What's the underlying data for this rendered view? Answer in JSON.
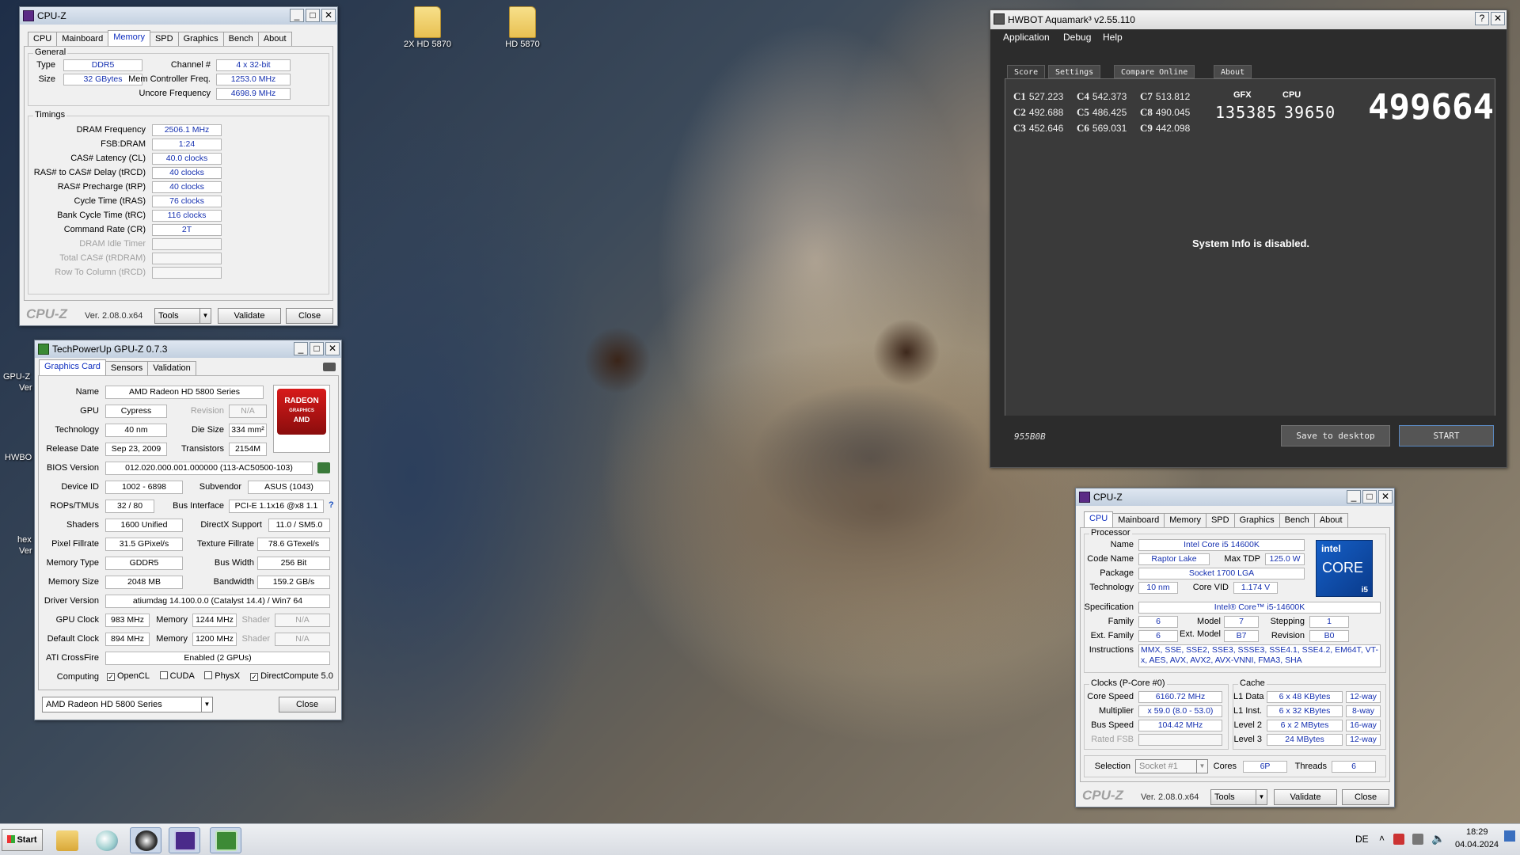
{
  "desktop": {
    "icons": [
      {
        "label": "2X HD 5870"
      },
      {
        "label": "HD 5870"
      }
    ],
    "partial_labels": [
      "GPU-Z",
      "Ver",
      "HWBO",
      "hex",
      "Ver"
    ]
  },
  "cpuz_mem": {
    "title": "CPU-Z",
    "tabs": [
      "CPU",
      "Mainboard",
      "Memory",
      "SPD",
      "Graphics",
      "Bench",
      "About"
    ],
    "active_tab": "Memory",
    "general": {
      "title": "General",
      "type_label": "Type",
      "type": "DDR5",
      "size_label": "Size",
      "size": "32 GBytes",
      "channel_label": "Channel #",
      "channel": "4 x 32-bit",
      "mcf_label": "Mem Controller Freq.",
      "mcf": "1253.0 MHz",
      "uncore_label": "Uncore Frequency",
      "uncore": "4698.9 MHz"
    },
    "timings": {
      "title": "Timings",
      "rows": [
        {
          "label": "DRAM Frequency",
          "value": "2506.1 MHz"
        },
        {
          "label": "FSB:DRAM",
          "value": "1:24"
        },
        {
          "label": "CAS# Latency (CL)",
          "value": "40.0 clocks"
        },
        {
          "label": "RAS# to CAS# Delay (tRCD)",
          "value": "40 clocks"
        },
        {
          "label": "RAS# Precharge (tRP)",
          "value": "40 clocks"
        },
        {
          "label": "Cycle Time (tRAS)",
          "value": "76 clocks"
        },
        {
          "label": "Bank Cycle Time (tRC)",
          "value": "116 clocks"
        },
        {
          "label": "Command Rate (CR)",
          "value": "2T"
        },
        {
          "label": "DRAM Idle Timer",
          "value": ""
        },
        {
          "label": "Total CAS# (tRDRAM)",
          "value": ""
        },
        {
          "label": "Row To Column (tRCD)",
          "value": ""
        }
      ]
    },
    "brand": "CPU-Z",
    "version": "Ver. 2.08.0.x64",
    "tools": "Tools",
    "validate": "Validate",
    "close": "Close"
  },
  "gpuz": {
    "title": "TechPowerUp GPU-Z 0.7.3",
    "tabs": [
      "Graphics Card",
      "Sensors",
      "Validation"
    ],
    "logo_text": "RADEON GRAPHICS AMD",
    "name_label": "Name",
    "name": "AMD Radeon HD 5800 Series",
    "gpu_label": "GPU",
    "gpu": "Cypress",
    "revision_label": "Revision",
    "revision": "N/A",
    "tech_label": "Technology",
    "tech": "40 nm",
    "die_label": "Die Size",
    "die": "334 mm²",
    "release_label": "Release Date",
    "release": "Sep 23, 2009",
    "trans_label": "Transistors",
    "trans": "2154M",
    "bios_label": "BIOS Version",
    "bios": "012.020.000.001.000000 (113-AC50500-103)",
    "devid_label": "Device ID",
    "devid": "1002 - 6898",
    "subv_label": "Subvendor",
    "subv": "ASUS (1043)",
    "rops_label": "ROPs/TMUs",
    "rops": "32 / 80",
    "bus_label": "Bus Interface",
    "bus": "PCI-E 1.1x16 @x8 1.1",
    "shaders_label": "Shaders",
    "shaders": "1600 Unified",
    "dx_label": "DirectX Support",
    "dx": "11.0 / SM5.0",
    "pixel_label": "Pixel Fillrate",
    "pixel": "31.5 GPixel/s",
    "tex_label": "Texture Fillrate",
    "tex": "78.6 GTexel/s",
    "memtype_label": "Memory Type",
    "memtype": "GDDR5",
    "buswidth_label": "Bus Width",
    "buswidth": "256 Bit",
    "memsize_label": "Memory Size",
    "memsize": "2048 MB",
    "bw_label": "Bandwidth",
    "bw": "159.2 GB/s",
    "driver_label": "Driver Version",
    "driver": "atiumdag 14.100.0.0 (Catalyst 14.4) / Win7 64",
    "gpuclock_label": "GPU Clock",
    "gpuclock": "983 MHz",
    "mem_label": "Memory",
    "memclock": "1244 MHz",
    "shader_label": "Shader",
    "shader": "N/A",
    "defclock_label": "Default Clock",
    "defclock": "894 MHz",
    "defmem": "1200 MHz",
    "defshader": "N/A",
    "crossfire_label": "ATI CrossFire",
    "crossfire": "Enabled (2 GPUs)",
    "computing_label": "Computing",
    "opencl": "OpenCL",
    "cuda": "CUDA",
    "physx": "PhysX",
    "dc": "DirectCompute 5.0",
    "select": "AMD Radeon HD 5800 Series",
    "close": "Close",
    "help": "?"
  },
  "aquamark": {
    "title": "HWBOT Aquamark³ v2.55.110",
    "menu": [
      "Application",
      "Debug",
      "Help"
    ],
    "tabs": [
      "Score",
      "Settings",
      "Compare Online",
      "About"
    ],
    "scores": [
      [
        {
          "k": "C1",
          "v": "527.223"
        },
        {
          "k": "C4",
          "v": "542.373"
        },
        {
          "k": "C7",
          "v": "513.812"
        }
      ],
      [
        {
          "k": "C2",
          "v": "492.688"
        },
        {
          "k": "C5",
          "v": "486.425"
        },
        {
          "k": "C8",
          "v": "490.045"
        }
      ],
      [
        {
          "k": "C3",
          "v": "452.646"
        },
        {
          "k": "C6",
          "v": "569.031"
        },
        {
          "k": "C9",
          "v": "442.098"
        }
      ]
    ],
    "gfx_label": "GFX",
    "gfx": "135385",
    "cpu_label": "CPU",
    "cpu": "39650",
    "total": "499664",
    "sysinfo": "System Info is disabled.",
    "code": "955B0B",
    "save": "Save to desktop",
    "start": "START"
  },
  "cpuz_cpu": {
    "title": "CPU-Z",
    "tabs": [
      "CPU",
      "Mainboard",
      "Memory",
      "SPD",
      "Graphics",
      "Bench",
      "About"
    ],
    "active_tab": "CPU",
    "processor_title": "Processor",
    "name_label": "Name",
    "name": "Intel Core i5 14600K",
    "codename_label": "Code Name",
    "codename": "Raptor Lake",
    "tdp_label": "Max TDP",
    "tdp": "125.0 W",
    "package_label": "Package",
    "package": "Socket 1700 LGA",
    "tech_label": "Technology",
    "tech": "10 nm",
    "vid_label": "Core VID",
    "vid": "1.174 V",
    "spec_label": "Specification",
    "spec": "Intel® Core™ i5-14600K",
    "family_label": "Family",
    "family": "6",
    "model_label": "Model",
    "model": "7",
    "stepping_label": "Stepping",
    "stepping": "1",
    "extfam_label": "Ext. Family",
    "extfam": "6",
    "extmodel_label": "Ext. Model",
    "extmodel": "B7",
    "rev_label": "Revision",
    "rev": "B0",
    "instr_label": "Instructions",
    "instr": "MMX, SSE, SSE2, SSE3, SSSE3, SSE4.1, SSE4.2, EM64T, VT-x, AES, AVX, AVX2, AVX-VNNI, FMA3, SHA",
    "logo": {
      "brand": "intel",
      "line": "CORE",
      "tier": "i5"
    },
    "clocks_title": "Clocks (P-Core #0)",
    "corespeed_label": "Core Speed",
    "corespeed": "6160.72 MHz",
    "mult_label": "Multiplier",
    "mult": "x 59.0 (8.0 - 53.0)",
    "busspeed_label": "Bus Speed",
    "busspeed": "104.42 MHz",
    "ratedfsb_label": "Rated FSB",
    "ratedfsb": "",
    "cache_title": "Cache",
    "cache": [
      {
        "label": "L1 Data",
        "size": "6 x 48 KBytes",
        "way": "12-way"
      },
      {
        "label": "L1 Inst.",
        "size": "6 x 32 KBytes",
        "way": "8-way"
      },
      {
        "label": "Level 2",
        "size": "6 x 2 MBytes",
        "way": "16-way"
      },
      {
        "label": "Level 3",
        "size": "24 MBytes",
        "way": "12-way"
      }
    ],
    "selection_label": "Selection",
    "selection": "Socket #1",
    "cores_label": "Cores",
    "cores": "6P",
    "threads_label": "Threads",
    "threads": "6",
    "brand": "CPU-Z",
    "version": "Ver. 2.08.0.x64",
    "tools": "Tools",
    "validate": "Validate",
    "close": "Close"
  },
  "taskbar": {
    "start": "Start",
    "lang": "DE",
    "time": "18:29",
    "date": "04.04.2024"
  }
}
